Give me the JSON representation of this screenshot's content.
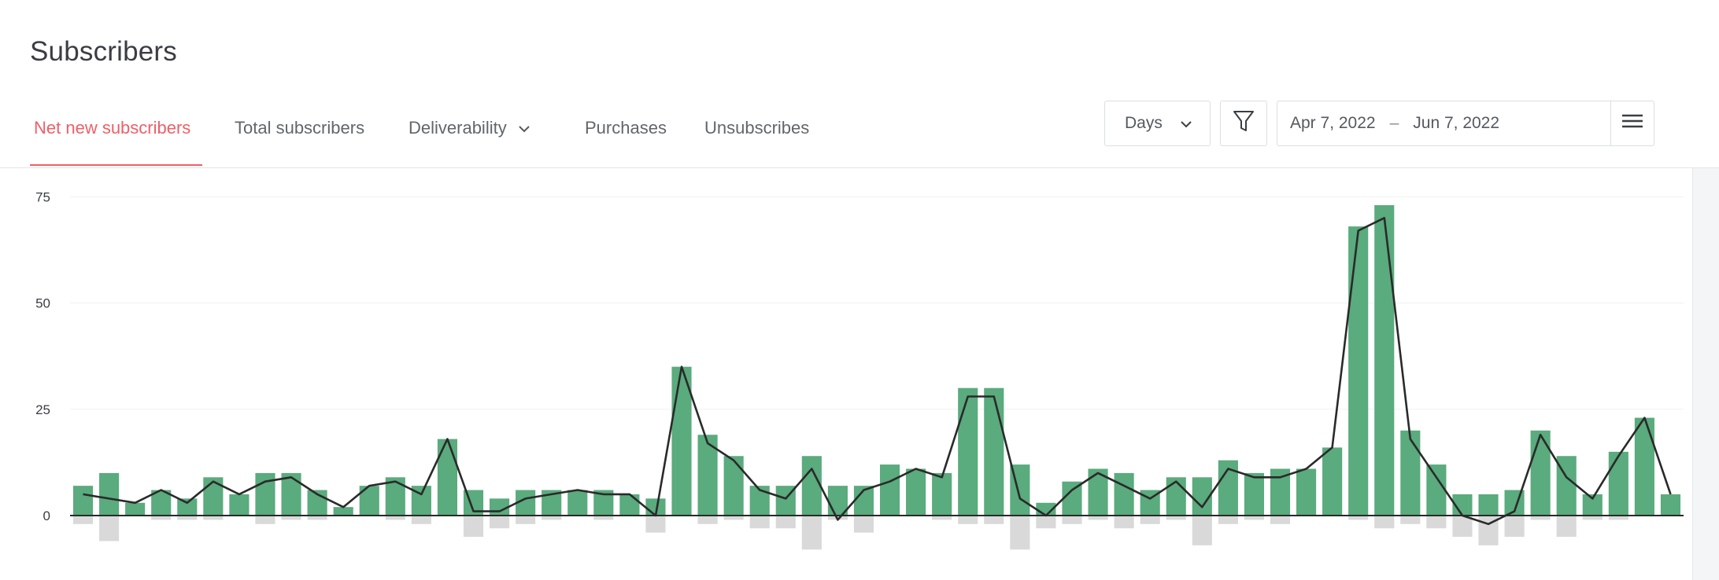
{
  "page": {
    "title": "Subscribers"
  },
  "tabs": [
    {
      "label": "Net new subscribers",
      "active": true
    },
    {
      "label": "Total subscribers",
      "active": false
    },
    {
      "label": "Deliverability",
      "active": false,
      "has_dropdown": true
    },
    {
      "label": "Purchases",
      "active": false
    },
    {
      "label": "Unsubscribes",
      "active": false
    }
  ],
  "controls": {
    "granularity": "Days",
    "date_start": "Apr 7, 2022",
    "date_separator": "–",
    "date_end": "Jun 7, 2022"
  },
  "colors": {
    "accent": "#ef5f67",
    "bar_positive": "#5aab7d",
    "bar_negative": "#d9d9d9",
    "line": "#2a2a2a"
  },
  "icons": [
    "chevron-down-icon",
    "filter-icon",
    "menu-icon"
  ],
  "chart_data": {
    "type": "bar",
    "ylim": [
      -8,
      75
    ],
    "yticks": [
      "0",
      "25",
      "50",
      "75"
    ],
    "series": [
      {
        "values": [
          7,
          10,
          3,
          6,
          4,
          9,
          5,
          10,
          10,
          6,
          2,
          7,
          9,
          7,
          18,
          6,
          4,
          6,
          6,
          6,
          6,
          5,
          4,
          35,
          19,
          14,
          7,
          7,
          14,
          7,
          7,
          12,
          11,
          10,
          30,
          30,
          12,
          3,
          8,
          11,
          10,
          6,
          9,
          9,
          13,
          10,
          11,
          11,
          16,
          68,
          73,
          20,
          12,
          5,
          5,
          6,
          20,
          14,
          5,
          15,
          23,
          5
        ]
      },
      {
        "values": [
          -2,
          -6,
          0,
          -1,
          -1,
          -1,
          0,
          -2,
          -1,
          -1,
          0,
          0,
          -1,
          -2,
          0,
          -5,
          -3,
          -2,
          -1,
          0,
          -1,
          0,
          -4,
          0,
          -2,
          -1,
          -3,
          -3,
          -8,
          -1,
          -4,
          0,
          0,
          -1,
          -2,
          -2,
          -8,
          -3,
          -2,
          -1,
          -3,
          -2,
          -1,
          -7,
          -2,
          -1,
          -2,
          0,
          0,
          -1,
          -3,
          -2,
          -3,
          -5,
          -7,
          -5,
          -1,
          -5,
          -1,
          -1,
          0,
          0
        ]
      },
      {
        "values": [
          5,
          4,
          3,
          6,
          3,
          8,
          5,
          8,
          9,
          5,
          2,
          7,
          8,
          5,
          18,
          1,
          1,
          4,
          5,
          6,
          5,
          5,
          0,
          35,
          17,
          13,
          6,
          4,
          11,
          -1,
          6,
          8,
          11,
          9,
          28,
          28,
          4,
          0,
          6,
          10,
          7,
          4,
          8,
          2,
          11,
          9,
          9,
          11,
          16,
          67,
          70,
          18,
          9,
          0,
          -2,
          1,
          19,
          9,
          4,
          14,
          23,
          5
        ]
      }
    ]
  }
}
